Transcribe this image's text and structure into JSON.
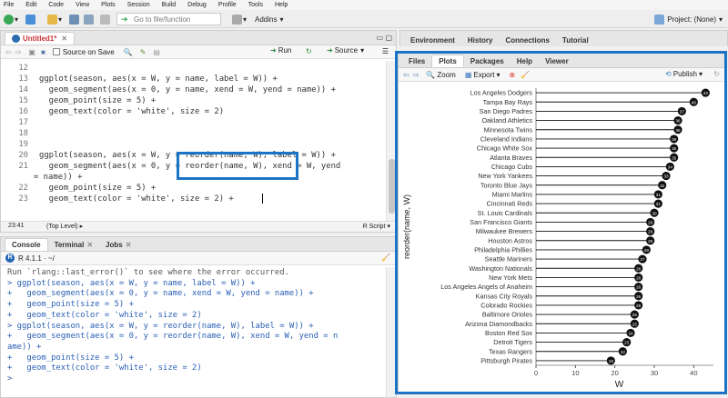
{
  "menu": [
    "File",
    "Edit",
    "Code",
    "View",
    "Plots",
    "Session",
    "Build",
    "Debug",
    "Profile",
    "Tools",
    "Help"
  ],
  "toolbar": {
    "goto_placeholder": "Go to file/function",
    "addins": "Addins",
    "project": "Project: (None)"
  },
  "editor": {
    "tab_label": "Untitled1*",
    "source_on_save": "Source on Save",
    "run": "Run",
    "source": "Source",
    "lines": [
      {
        "n": "12",
        "code": ""
      },
      {
        "n": "13",
        "code": "ggplot(season, aes(x = W, y = name, label = W)) +"
      },
      {
        "n": "14",
        "code": "  geom_segment(aes(x = 0, y = name, xend = W, yend = name)) +"
      },
      {
        "n": "15",
        "code": "  geom_point(size = 5) +"
      },
      {
        "n": "16",
        "code": "  geom_text(color = 'white', size = 2)"
      },
      {
        "n": "17",
        "code": ""
      },
      {
        "n": "18",
        "code": ""
      },
      {
        "n": "19",
        "code": ""
      },
      {
        "n": "20",
        "code": "ggplot(season, aes(x = W, y = reorder(name, W), label = W)) +"
      },
      {
        "n": "21",
        "code": "  geom_segment(aes(x = 0, y = reorder(name, W), xend = W, yend"
      },
      {
        "n": "",
        "code": "= name)) +"
      },
      {
        "n": "22",
        "code": "  geom_point(size = 5) +"
      },
      {
        "n": "23",
        "code": "  geom_text(color = 'white', size = 2) +"
      }
    ],
    "status_pos": "23:41",
    "status_scope": "(Top Level)",
    "status_type": "R Script"
  },
  "console": {
    "tabs": [
      "Console",
      "Terminal",
      "Jobs"
    ],
    "version": "R 4.1.1 · ~/",
    "lines": [
      "Run `rlang::last_error()` to see where the error occurred.",
      "> ggplot(season, aes(x = W, y = name, label = W)) +",
      "+   geom_segment(aes(x = 0, y = name, xend = W, yend = name)) +",
      "+   geom_point(size = 5) +",
      "+   geom_text(color = 'white', size = 2)",
      "> ggplot(season, aes(x = W, y = reorder(name, W), label = W)) +",
      "+   geom_segment(aes(x = 0, y = reorder(name, W), xend = W, yend = n",
      "ame)) +",
      "+   geom_point(size = 5) +",
      "+   geom_text(color = 'white', size = 2)",
      "> "
    ]
  },
  "env_tabs": [
    "Environment",
    "History",
    "Connections",
    "Tutorial"
  ],
  "files_tabs": [
    "Files",
    "Plots",
    "Packages",
    "Help",
    "Viewer"
  ],
  "plots_toolbar": {
    "zoom": "Zoom",
    "export": "Export",
    "publish": "Publish"
  },
  "chart_data": {
    "type": "lollipop",
    "ylabel": "reorder(name, W)",
    "xlabel": "W",
    "xlim": [
      0,
      45
    ],
    "xticks": [
      0,
      10,
      20,
      30,
      40
    ],
    "categories": [
      "Los Angeles Dodgers",
      "Tampa Bay Rays",
      "San Diego Padres",
      "Oakland Athletics",
      "Minnesota Twins",
      "Cleveland Indians",
      "Chicago White Sox",
      "Atlanta Braves",
      "Chicago Cubs",
      "New York Yankees",
      "Toronto Blue Jays",
      "Miami Marlins",
      "Cincinnati Reds",
      "St. Louis Cardinals",
      "San Francisco Giants",
      "Milwaukee Brewers",
      "Houston Astros",
      "Philadelphia Phillies",
      "Seattle Mariners",
      "Washington Nationals",
      "New York Mets",
      "Los Angeles Angels of Anaheim",
      "Kansas City Royals",
      "Colorado Rockies",
      "Baltimore Orioles",
      "Arizona Diamondbacks",
      "Boston Red Sox",
      "Detroit Tigers",
      "Texas Rangers",
      "Pittsburgh Pirates"
    ],
    "values": [
      43,
      40,
      37,
      36,
      36,
      35,
      35,
      35,
      34,
      33,
      32,
      31,
      31,
      30,
      29,
      29,
      29,
      28,
      27,
      26,
      26,
      26,
      26,
      26,
      25,
      25,
      24,
      23,
      22,
      19
    ]
  }
}
